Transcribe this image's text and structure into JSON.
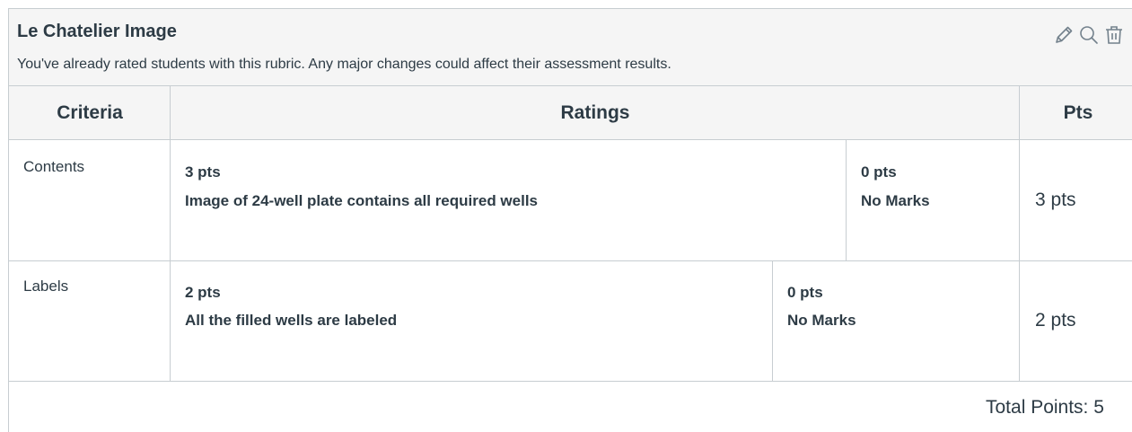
{
  "rubric": {
    "title": "Le Chatelier Image",
    "warning": "You've already rated students with this rubric. Any major changes could affect their assessment results.",
    "actions": [
      {
        "icon": "pencil-icon"
      },
      {
        "icon": "search-icon"
      },
      {
        "icon": "trash-icon"
      }
    ]
  },
  "table": {
    "headers": {
      "criteria": "Criteria",
      "ratings": "Ratings",
      "pts": "Pts"
    },
    "rows": [
      {
        "criterion": "Contents",
        "ratings": [
          {
            "points": "3 pts",
            "description": "Image of 24-well plate contains all required wells"
          },
          {
            "points": "0 pts",
            "description": "No Marks"
          }
        ],
        "pts": "3 pts"
      },
      {
        "criterion": "Labels",
        "ratings": [
          {
            "points": "2 pts",
            "description": "All the filled wells are labeled"
          },
          {
            "points": "0 pts",
            "description": "No Marks"
          }
        ],
        "pts": "2 pts"
      }
    ],
    "total": "Total Points: 5"
  },
  "colors": {
    "text": "#2d3b45",
    "header_bg": "#f5f5f5",
    "border": "#c7cdd1",
    "icon": "#73818c"
  }
}
